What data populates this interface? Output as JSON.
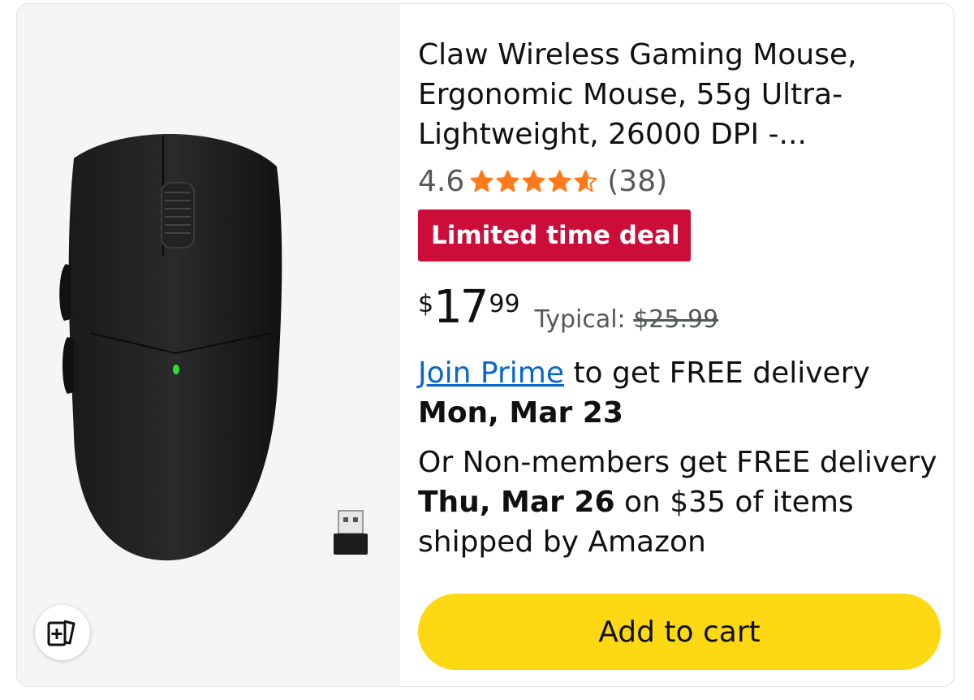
{
  "product": {
    "title": "Claw Wireless Gaming Mouse, Ergonomic Mouse, 55g Ultra-Lightweight, 26000 DPI -...",
    "rating_value": "4.6",
    "rating": 4.6,
    "review_count": "(38)",
    "deal_badge": "Limited time deal",
    "price": {
      "symbol": "$",
      "whole": "17",
      "fraction": "99"
    },
    "typical_label": "Typical:",
    "typical_price": "$25.99"
  },
  "delivery": {
    "prime_link": "Join Prime",
    "prime_text": " to get FREE delivery ",
    "prime_date": "Mon, Mar 23",
    "nonprime_text_1": "Or Non-members get FREE delivery ",
    "nonprime_date": "Thu, Mar 26",
    "nonprime_text_2": " on $35 of items shipped by Amazon"
  },
  "actions": {
    "add_to_cart": "Add to cart"
  },
  "icons": {
    "compare": "compare-cards-icon",
    "star": "star-icon"
  },
  "colors": {
    "deal_red": "#cc0c39",
    "star_orange": "#ff7a1a",
    "cart_yellow": "#ffd814",
    "link_blue": "#0a67c8"
  }
}
